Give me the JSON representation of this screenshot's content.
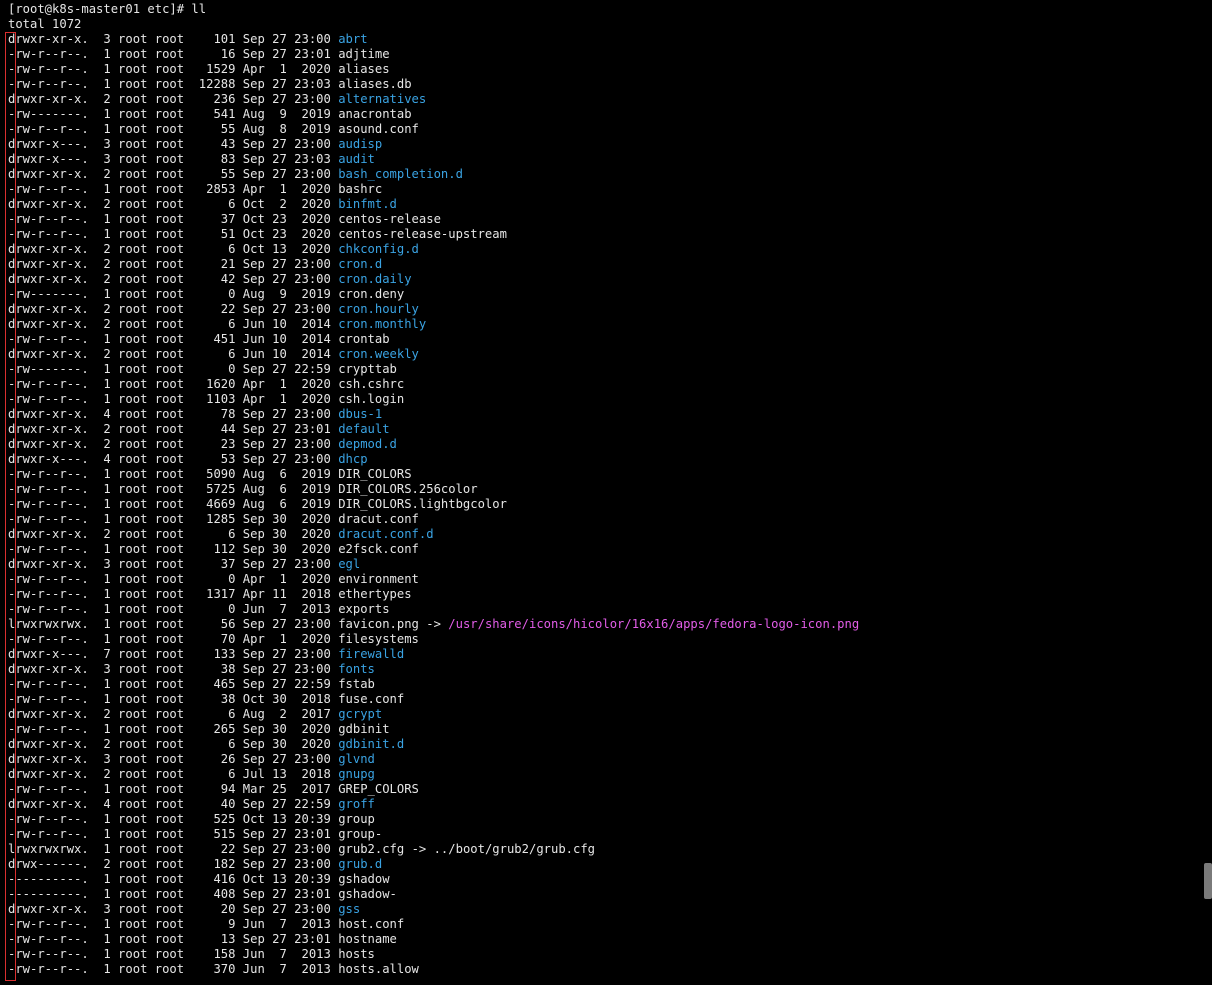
{
  "colors": {
    "directory": "#3aa3e3",
    "symlink_target": "#e25de8",
    "text": "#e6e6e6",
    "highlight_border": "#d92f2f",
    "background": "#000000"
  },
  "prompt": "[root@k8s-master01 etc]# ll",
  "total": "total 1072",
  "entries": [
    {
      "meta": "drwxr-xr-x.  3 root root    101 Sep 27 23:00 ",
      "name": "abrt",
      "type": "dir"
    },
    {
      "meta": "-rw-r--r--.  1 root root     16 Sep 27 23:01 ",
      "name": "adjtime",
      "type": "file"
    },
    {
      "meta": "-rw-r--r--.  1 root root   1529 Apr  1  2020 ",
      "name": "aliases",
      "type": "file"
    },
    {
      "meta": "-rw-r--r--.  1 root root  12288 Sep 27 23:03 ",
      "name": "aliases.db",
      "type": "file"
    },
    {
      "meta": "drwxr-xr-x.  2 root root    236 Sep 27 23:00 ",
      "name": "alternatives",
      "type": "dir"
    },
    {
      "meta": "-rw-------.  1 root root    541 Aug  9  2019 ",
      "name": "anacrontab",
      "type": "file"
    },
    {
      "meta": "-rw-r--r--.  1 root root     55 Aug  8  2019 ",
      "name": "asound.conf",
      "type": "file"
    },
    {
      "meta": "drwxr-x---.  3 root root     43 Sep 27 23:00 ",
      "name": "audisp",
      "type": "dir"
    },
    {
      "meta": "drwxr-x---.  3 root root     83 Sep 27 23:03 ",
      "name": "audit",
      "type": "dir"
    },
    {
      "meta": "drwxr-xr-x.  2 root root     55 Sep 27 23:00 ",
      "name": "bash_completion.d",
      "type": "dir"
    },
    {
      "meta": "-rw-r--r--.  1 root root   2853 Apr  1  2020 ",
      "name": "bashrc",
      "type": "file"
    },
    {
      "meta": "drwxr-xr-x.  2 root root      6 Oct  2  2020 ",
      "name": "binfmt.d",
      "type": "dir"
    },
    {
      "meta": "-rw-r--r--.  1 root root     37 Oct 23  2020 ",
      "name": "centos-release",
      "type": "file"
    },
    {
      "meta": "-rw-r--r--.  1 root root     51 Oct 23  2020 ",
      "name": "centos-release-upstream",
      "type": "file"
    },
    {
      "meta": "drwxr-xr-x.  2 root root      6 Oct 13  2020 ",
      "name": "chkconfig.d",
      "type": "dir"
    },
    {
      "meta": "drwxr-xr-x.  2 root root     21 Sep 27 23:00 ",
      "name": "cron.d",
      "type": "dir"
    },
    {
      "meta": "drwxr-xr-x.  2 root root     42 Sep 27 23:00 ",
      "name": "cron.daily",
      "type": "dir"
    },
    {
      "meta": "-rw-------.  1 root root      0 Aug  9  2019 ",
      "name": "cron.deny",
      "type": "file"
    },
    {
      "meta": "drwxr-xr-x.  2 root root     22 Sep 27 23:00 ",
      "name": "cron.hourly",
      "type": "dir"
    },
    {
      "meta": "drwxr-xr-x.  2 root root      6 Jun 10  2014 ",
      "name": "cron.monthly",
      "type": "dir"
    },
    {
      "meta": "-rw-r--r--.  1 root root    451 Jun 10  2014 ",
      "name": "crontab",
      "type": "file"
    },
    {
      "meta": "drwxr-xr-x.  2 root root      6 Jun 10  2014 ",
      "name": "cron.weekly",
      "type": "dir"
    },
    {
      "meta": "-rw-------.  1 root root      0 Sep 27 22:59 ",
      "name": "crypttab",
      "type": "file"
    },
    {
      "meta": "-rw-r--r--.  1 root root   1620 Apr  1  2020 ",
      "name": "csh.cshrc",
      "type": "file"
    },
    {
      "meta": "-rw-r--r--.  1 root root   1103 Apr  1  2020 ",
      "name": "csh.login",
      "type": "file"
    },
    {
      "meta": "drwxr-xr-x.  4 root root     78 Sep 27 23:00 ",
      "name": "dbus-1",
      "type": "dir"
    },
    {
      "meta": "drwxr-xr-x.  2 root root     44 Sep 27 23:01 ",
      "name": "default",
      "type": "dir"
    },
    {
      "meta": "drwxr-xr-x.  2 root root     23 Sep 27 23:00 ",
      "name": "depmod.d",
      "type": "dir"
    },
    {
      "meta": "drwxr-x---.  4 root root     53 Sep 27 23:00 ",
      "name": "dhcp",
      "type": "dir"
    },
    {
      "meta": "-rw-r--r--.  1 root root   5090 Aug  6  2019 ",
      "name": "DIR_COLORS",
      "type": "file"
    },
    {
      "meta": "-rw-r--r--.  1 root root   5725 Aug  6  2019 ",
      "name": "DIR_COLORS.256color",
      "type": "file"
    },
    {
      "meta": "-rw-r--r--.  1 root root   4669 Aug  6  2019 ",
      "name": "DIR_COLORS.lightbgcolor",
      "type": "file"
    },
    {
      "meta": "-rw-r--r--.  1 root root   1285 Sep 30  2020 ",
      "name": "dracut.conf",
      "type": "file"
    },
    {
      "meta": "drwxr-xr-x.  2 root root      6 Sep 30  2020 ",
      "name": "dracut.conf.d",
      "type": "dir"
    },
    {
      "meta": "-rw-r--r--.  1 root root    112 Sep 30  2020 ",
      "name": "e2fsck.conf",
      "type": "file"
    },
    {
      "meta": "drwxr-xr-x.  3 root root     37 Sep 27 23:00 ",
      "name": "egl",
      "type": "dir"
    },
    {
      "meta": "-rw-r--r--.  1 root root      0 Apr  1  2020 ",
      "name": "environment",
      "type": "file"
    },
    {
      "meta": "-rw-r--r--.  1 root root   1317 Apr 11  2018 ",
      "name": "ethertypes",
      "type": "file"
    },
    {
      "meta": "-rw-r--r--.  1 root root      0 Jun  7  2013 ",
      "name": "exports",
      "type": "file"
    },
    {
      "meta": "lrwxrwxrwx.  1 root root     56 Sep 27 23:00 ",
      "name": "favicon.png",
      "type": "link",
      "arrow": " -> ",
      "target": "/usr/share/icons/hicolor/16x16/apps/fedora-logo-icon.png",
      "target_colored": true
    },
    {
      "meta": "-rw-r--r--.  1 root root     70 Apr  1  2020 ",
      "name": "filesystems",
      "type": "file"
    },
    {
      "meta": "drwxr-x---.  7 root root    133 Sep 27 23:00 ",
      "name": "firewalld",
      "type": "dir"
    },
    {
      "meta": "drwxr-xr-x.  3 root root     38 Sep 27 23:00 ",
      "name": "fonts",
      "type": "dir"
    },
    {
      "meta": "-rw-r--r--.  1 root root    465 Sep 27 22:59 ",
      "name": "fstab",
      "type": "file"
    },
    {
      "meta": "-rw-r--r--.  1 root root     38 Oct 30  2018 ",
      "name": "fuse.conf",
      "type": "file"
    },
    {
      "meta": "drwxr-xr-x.  2 root root      6 Aug  2  2017 ",
      "name": "gcrypt",
      "type": "dir"
    },
    {
      "meta": "-rw-r--r--.  1 root root    265 Sep 30  2020 ",
      "name": "gdbinit",
      "type": "file"
    },
    {
      "meta": "drwxr-xr-x.  2 root root      6 Sep 30  2020 ",
      "name": "gdbinit.d",
      "type": "dir"
    },
    {
      "meta": "drwxr-xr-x.  3 root root     26 Sep 27 23:00 ",
      "name": "glvnd",
      "type": "dir"
    },
    {
      "meta": "drwxr-xr-x.  2 root root      6 Jul 13  2018 ",
      "name": "gnupg",
      "type": "dir"
    },
    {
      "meta": "-rw-r--r--.  1 root root     94 Mar 25  2017 ",
      "name": "GREP_COLORS",
      "type": "file"
    },
    {
      "meta": "drwxr-xr-x.  4 root root     40 Sep 27 22:59 ",
      "name": "groff",
      "type": "dir"
    },
    {
      "meta": "-rw-r--r--.  1 root root    525 Oct 13 20:39 ",
      "name": "group",
      "type": "file"
    },
    {
      "meta": "-rw-r--r--.  1 root root    515 Sep 27 23:01 ",
      "name": "group-",
      "type": "file"
    },
    {
      "meta": "lrwxrwxrwx.  1 root root     22 Sep 27 23:00 ",
      "name": "grub2.cfg",
      "type": "link",
      "arrow": " -> ",
      "target": "../boot/grub2/grub.cfg",
      "target_colored": false
    },
    {
      "meta": "drwx------.  2 root root    182 Sep 27 23:00 ",
      "name": "grub.d",
      "type": "dir"
    },
    {
      "meta": "----------.  1 root root    416 Oct 13 20:39 ",
      "name": "gshadow",
      "type": "file"
    },
    {
      "meta": "----------.  1 root root    408 Sep 27 23:01 ",
      "name": "gshadow-",
      "type": "file"
    },
    {
      "meta": "drwxr-xr-x.  3 root root     20 Sep 27 23:00 ",
      "name": "gss",
      "type": "dir"
    },
    {
      "meta": "-rw-r--r--.  1 root root      9 Jun  7  2013 ",
      "name": "host.conf",
      "type": "file"
    },
    {
      "meta": "-rw-r--r--.  1 root root     13 Sep 27 23:01 ",
      "name": "hostname",
      "type": "file"
    },
    {
      "meta": "-rw-r--r--.  1 root root    158 Jun  7  2013 ",
      "name": "hosts",
      "type": "file"
    },
    {
      "meta": "-rw-r--r--.  1 root root    370 Jun  7  2013 ",
      "name": "hosts.allow",
      "type": "file"
    }
  ]
}
